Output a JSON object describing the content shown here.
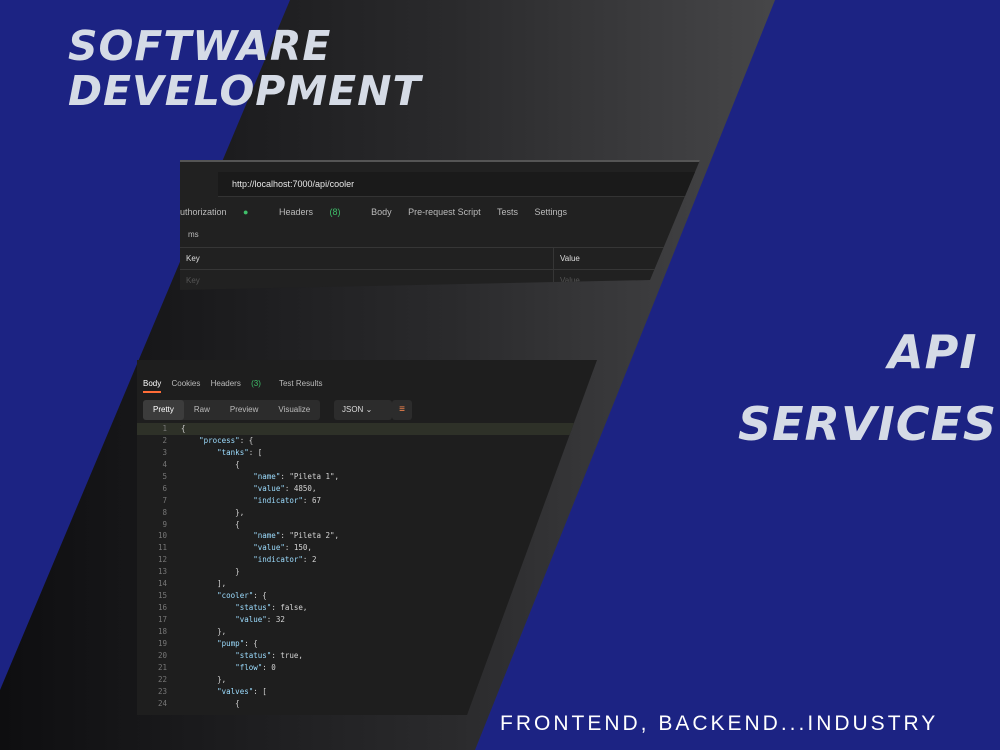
{
  "headline": {
    "line1": "SOFTWARE",
    "line2": "DEVELOPMENT"
  },
  "subheadline": {
    "line1": "API",
    "line2": "SERVICES"
  },
  "tagline": "FRONTEND, BACKEND...INDUSTRY",
  "colors": {
    "brand_blue": "#1c2383",
    "title_text": "#d5dbe6",
    "accent_orange": "#ff6c37",
    "status_green": "#3fbf6a"
  },
  "request": {
    "url": "http://localhost:7000/api/cooler",
    "tabs": [
      "uthorization",
      "Headers",
      "Body",
      "Pre-request Script",
      "Tests",
      "Settings"
    ],
    "headers_count": "(8)",
    "params_label": "ms",
    "table": {
      "key_header": "Key",
      "value_header": "Value",
      "key_placeholder": "Key",
      "value_placeholder": "Value"
    }
  },
  "response": {
    "tabs": [
      "Body",
      "Cookies",
      "Headers",
      "Test Results"
    ],
    "headers_count": "(3)",
    "view_modes": [
      "Pretty",
      "Raw",
      "Preview",
      "Visualize"
    ],
    "format": "JSON",
    "line_numbers": [
      "1",
      "2",
      "3",
      "4",
      "5",
      "6",
      "7",
      "8",
      "9",
      "10",
      "11",
      "12",
      "13",
      "14",
      "15",
      "16",
      "17",
      "18",
      "19",
      "20",
      "21",
      "22",
      "23",
      "24"
    ],
    "json_lines": [
      "{",
      "    \"process\": {",
      "        \"tanks\": [",
      "            {",
      "                \"name\": \"Pileta 1\",",
      "                \"value\": 4850,",
      "                \"indicator\": 67",
      "            },",
      "            {",
      "                \"name\": \"Pileta 2\",",
      "                \"value\": 150,",
      "                \"indicator\": 2",
      "            }",
      "        ],",
      "        \"cooler\": {",
      "            \"status\": false,",
      "            \"value\": 32",
      "        },",
      "        \"pump\": {",
      "            \"status\": true,",
      "            \"flow\": 0",
      "        },",
      "        \"valves\": [",
      "            {"
    ]
  }
}
